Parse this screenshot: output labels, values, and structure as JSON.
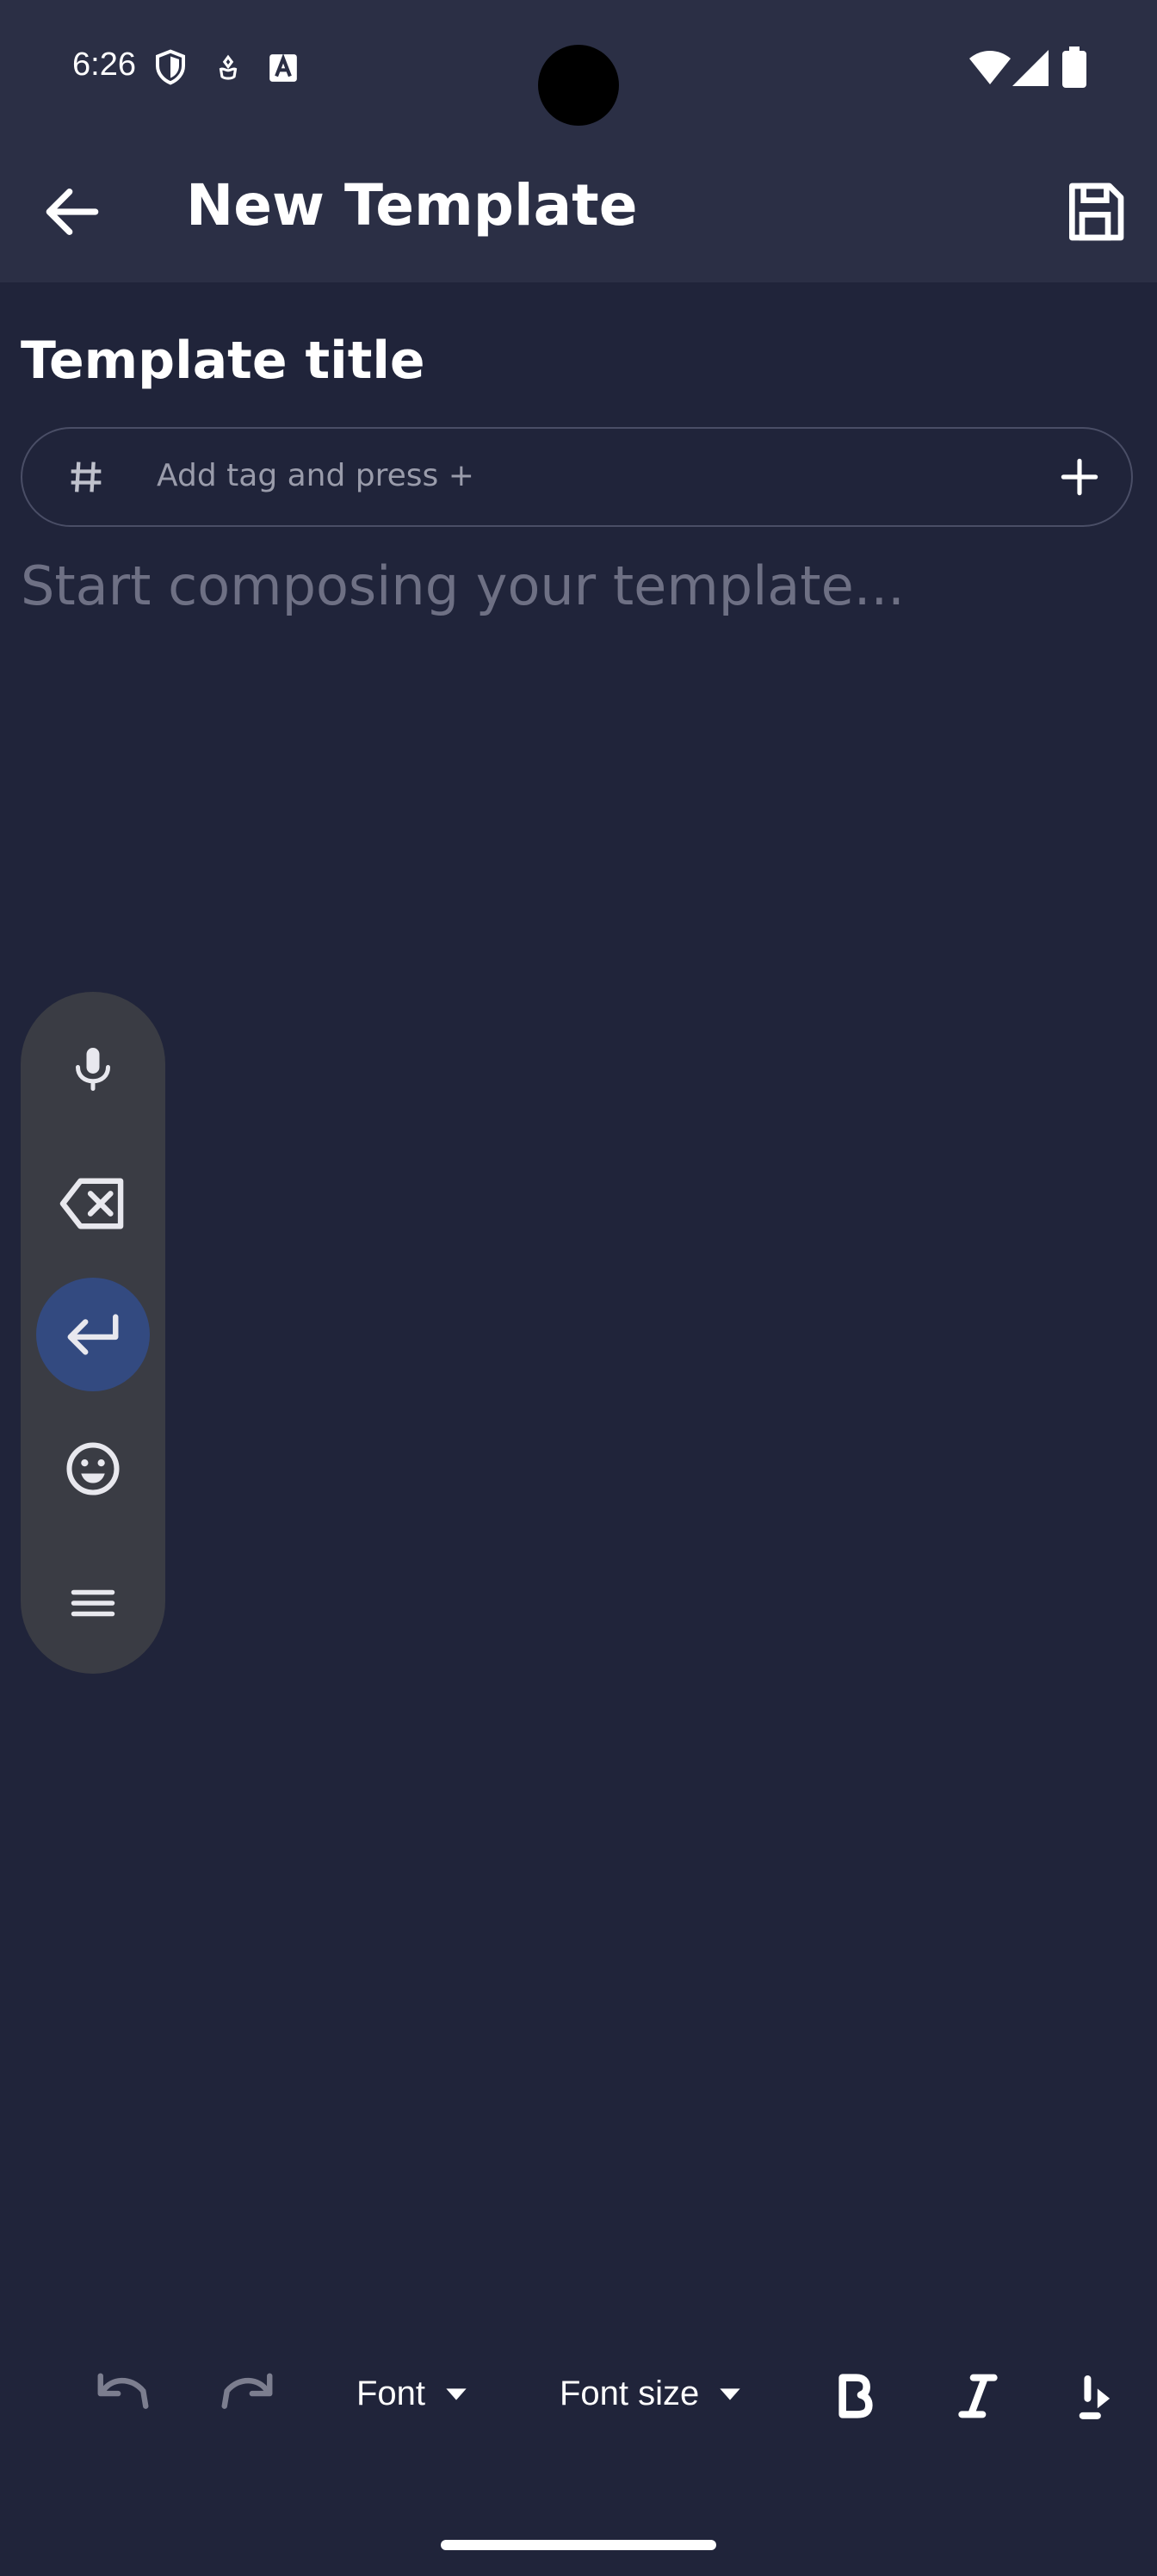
{
  "status_bar": {
    "time": "6:26",
    "icons": [
      "shield-icon",
      "hand-icon",
      "a-box-icon",
      "wifi-icon",
      "signal-icon",
      "battery-icon"
    ]
  },
  "app_bar": {
    "title": "New Template",
    "back_icon": "arrow-left-icon",
    "save_icon": "floppy-disk-icon"
  },
  "editor": {
    "title_text": "Template title",
    "tag_input_placeholder": "Add tag and press +",
    "compose_placeholder": "Start composing your template..."
  },
  "keyboard_pill": {
    "buttons": [
      "microphone-icon",
      "backspace-icon",
      "enter-icon",
      "emoji-icon",
      "menu-icon"
    ]
  },
  "format_toolbar": {
    "undo_icon": "undo-icon",
    "redo_icon": "redo-icon",
    "font_label": "Font",
    "font_size_label": "Font size",
    "bold_icon": "bold-icon",
    "italic_icon": "italic-icon"
  },
  "colors": {
    "background": "#20243a",
    "app_bar": "#2b2f45",
    "pill": "#3a3c44",
    "accent": "#334a80"
  }
}
